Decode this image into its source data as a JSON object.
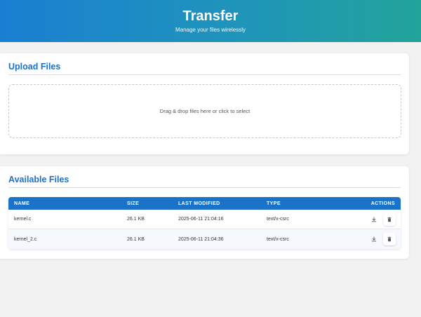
{
  "header": {
    "title": "Transfer",
    "subtitle": "Manage your files wirelessly"
  },
  "upload": {
    "title": "Upload Files",
    "dropzone_text": "Drag & drop files here or click to select"
  },
  "files": {
    "title": "Available Files",
    "columns": [
      "NAME",
      "SIZE",
      "LAST MODIFIED",
      "TYPE",
      "ACTIONS"
    ],
    "rows": [
      {
        "name": "kernel.c",
        "size": "26.1 KB",
        "modified": "2025-06-11 21:04:16",
        "type": "text/x-csrc"
      },
      {
        "name": "kernel_2.c",
        "size": "26.1 KB",
        "modified": "2025-06-11 21:04:36",
        "type": "text/x-csrc"
      }
    ]
  },
  "icons": {
    "download": "download-icon",
    "delete": "trash-icon"
  },
  "colors": {
    "accent": "#1b72c9",
    "header_start": "#1a7fd2",
    "header_end": "#22a39a"
  }
}
